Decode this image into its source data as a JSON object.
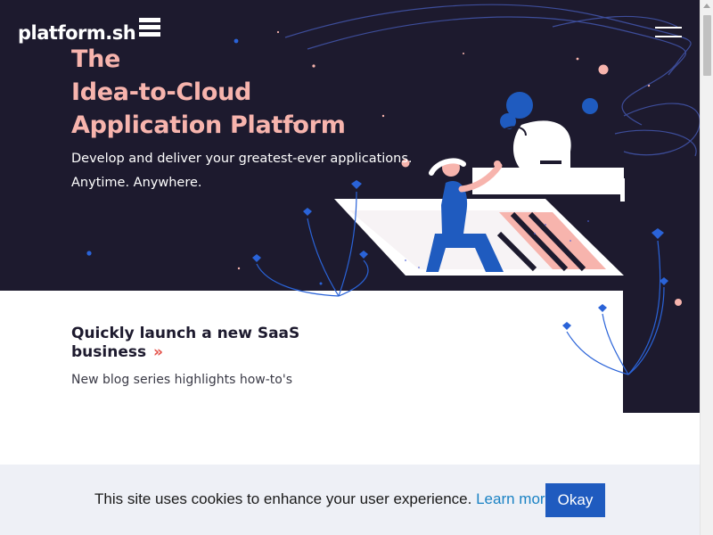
{
  "header": {
    "logo_text": "platform.sh",
    "logo_mark_icon": "stacked-bars-icon",
    "menu_icon": "hamburger-menu-icon"
  },
  "hero": {
    "title_lines": [
      "The",
      "Idea-to-Cloud",
      "Application Platform"
    ],
    "subtitle_lines": [
      "Develop and deliver your greatest-ever applications.",
      "Anytime. Anywhere."
    ],
    "illustration_icon": "people-on-flying-platform-illustration"
  },
  "promo": {
    "title": "Quickly launch a new SaaS business",
    "arrow_icon": "double-chevron-right-icon",
    "arrow_glyph": "»",
    "subtitle": "New blog series highlights how-to's"
  },
  "cookie": {
    "message": "This site uses cookies to enhance your user experience.",
    "link_label": "Learn more.",
    "button_label": "Okay"
  },
  "colors": {
    "hero_background": "#1d1a2e",
    "title_pink": "#f7b4ad",
    "accent_blue": "#1f5bbf",
    "arrow_red": "#e4524a",
    "cookie_background": "#eef0f6"
  }
}
